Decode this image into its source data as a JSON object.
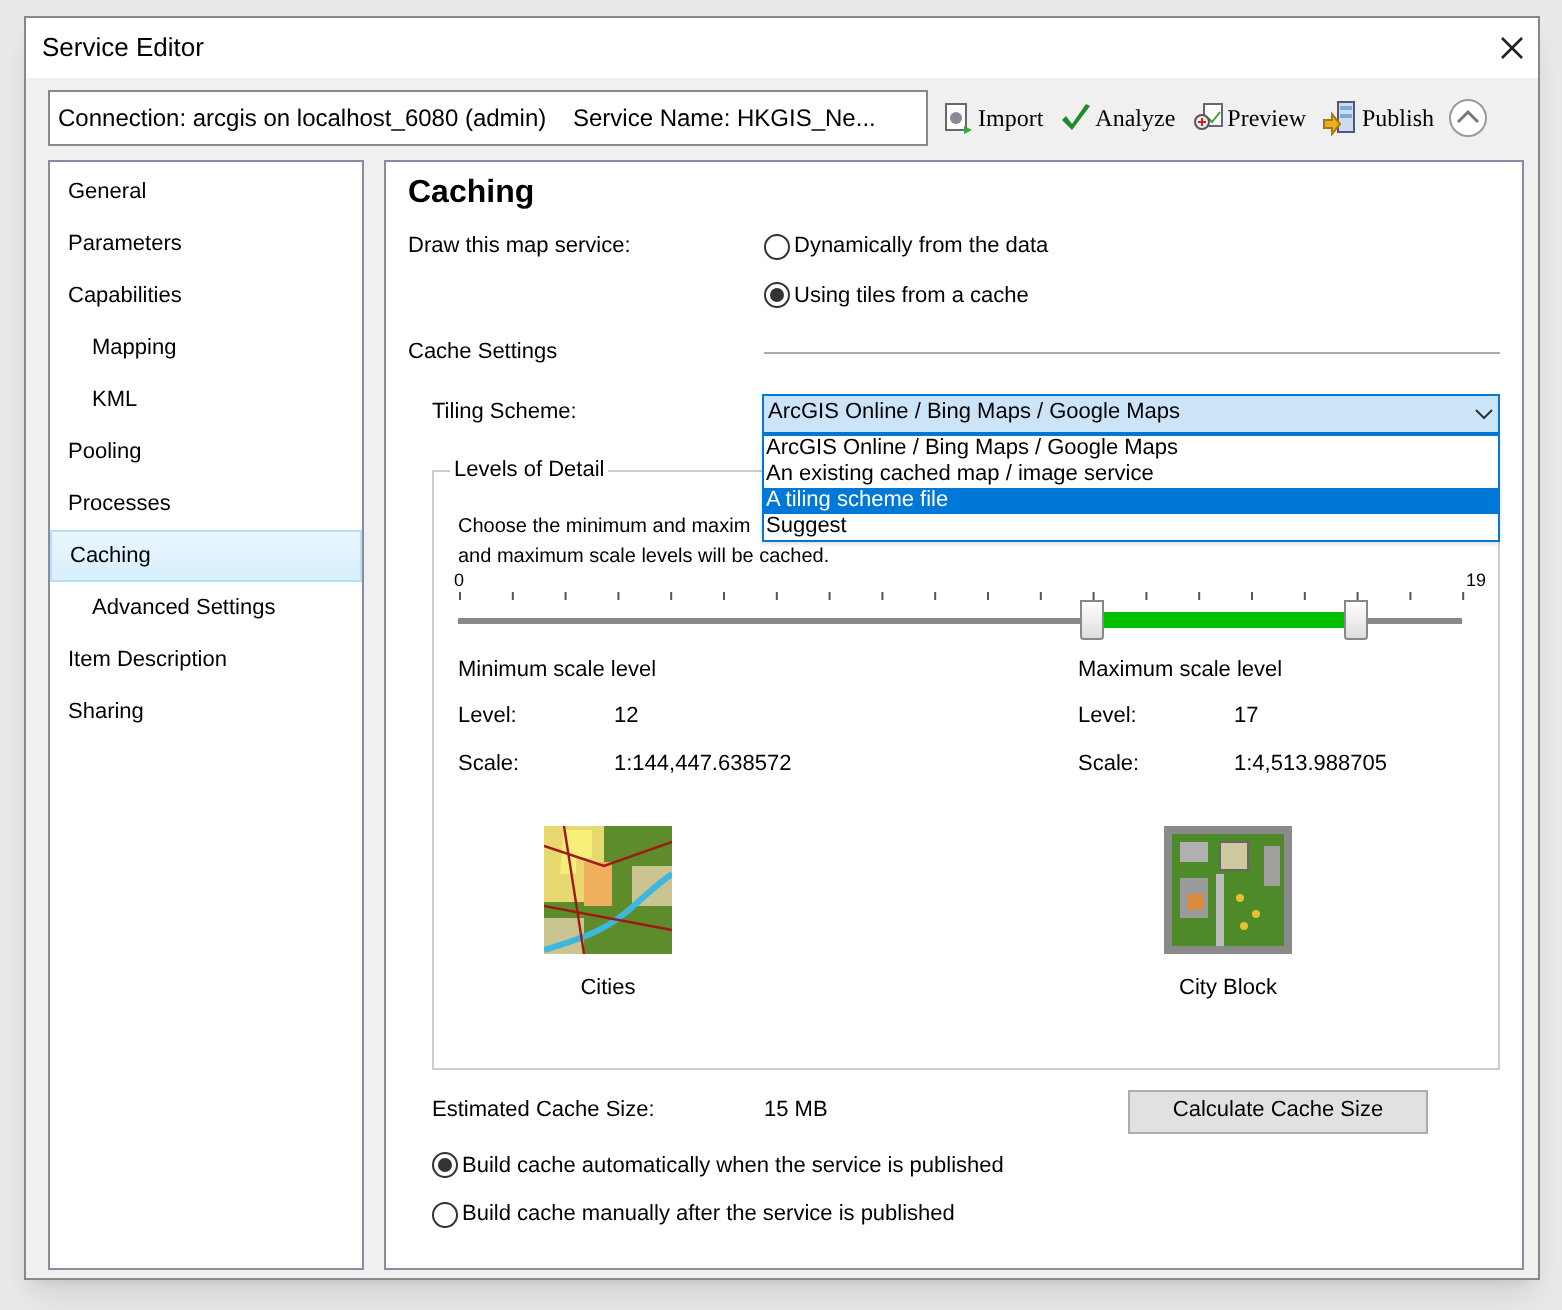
{
  "window": {
    "title": "Service Editor"
  },
  "connection": "Connection: arcgis on localhost_6080 (admin)    Service Name: HKGIS_Ne...",
  "toolbar": [
    {
      "kind": "import",
      "label": "Import"
    },
    {
      "kind": "analyze",
      "label": "Analyze"
    },
    {
      "kind": "preview",
      "label": "Preview"
    },
    {
      "kind": "publish",
      "label": "Publish"
    }
  ],
  "sidebar": {
    "items": [
      {
        "label": "General",
        "selected": false
      },
      {
        "label": "Parameters",
        "selected": false
      },
      {
        "label": "Capabilities",
        "selected": false,
        "children": [
          {
            "label": "Mapping",
            "selected": false
          },
          {
            "label": "KML",
            "selected": false
          }
        ]
      },
      {
        "label": "Pooling",
        "selected": false
      },
      {
        "label": "Processes",
        "selected": false
      },
      {
        "label": "Caching",
        "selected": true,
        "children": [
          {
            "label": "Advanced Settings",
            "selected": false
          }
        ]
      },
      {
        "label": "Item Description",
        "selected": false
      },
      {
        "label": "Sharing",
        "selected": false
      }
    ]
  },
  "page": {
    "title": "Caching",
    "draw_label": "Draw this map service:",
    "draw_options": [
      {
        "label": "Dynamically from the data",
        "selected": false
      },
      {
        "label": "Using tiles from a cache",
        "selected": true
      }
    ],
    "cache_settings": "Cache Settings",
    "tiling_label": "Tiling Scheme:",
    "tiling_value": "ArcGIS Online / Bing Maps / Google Maps",
    "tiling_options": [
      {
        "label": "ArcGIS Online / Bing Maps / Google Maps",
        "selected": false
      },
      {
        "label": "An existing cached map / image service",
        "selected": false
      },
      {
        "label": "A tiling scheme file",
        "selected": true
      },
      {
        "label": "Suggest",
        "selected": false
      }
    ],
    "lod": {
      "title": "Levels of Detail",
      "description_visible": [
        "Choose the minimum and maxim",
        "and maximum scale levels will be cached."
      ],
      "slider": {
        "min_label": "0",
        "max_label": "19",
        "thumbs": [
          {
            "level": 0.632
          },
          {
            "level": 0.895
          }
        ]
      },
      "scales": [
        {
          "heading": "Minimum scale level",
          "level_label": "Level:",
          "level": "12",
          "scale_label": "Scale:",
          "scale": "1:144,447.638572",
          "caption": "Cities"
        },
        {
          "heading": "Maximum scale level",
          "level_label": "Level:",
          "level": "17",
          "scale_label": "Scale:",
          "scale": "1:4,513.988705",
          "caption": "City Block"
        }
      ]
    },
    "estimate_label": "Estimated Cache Size:",
    "estimate_value": "15 MB",
    "calculate_button": "Calculate Cache Size",
    "build_options": [
      {
        "label": "Build cache automatically when the service is published",
        "selected": true
      },
      {
        "label": "Build cache manually after the service is published",
        "selected": false
      }
    ]
  }
}
